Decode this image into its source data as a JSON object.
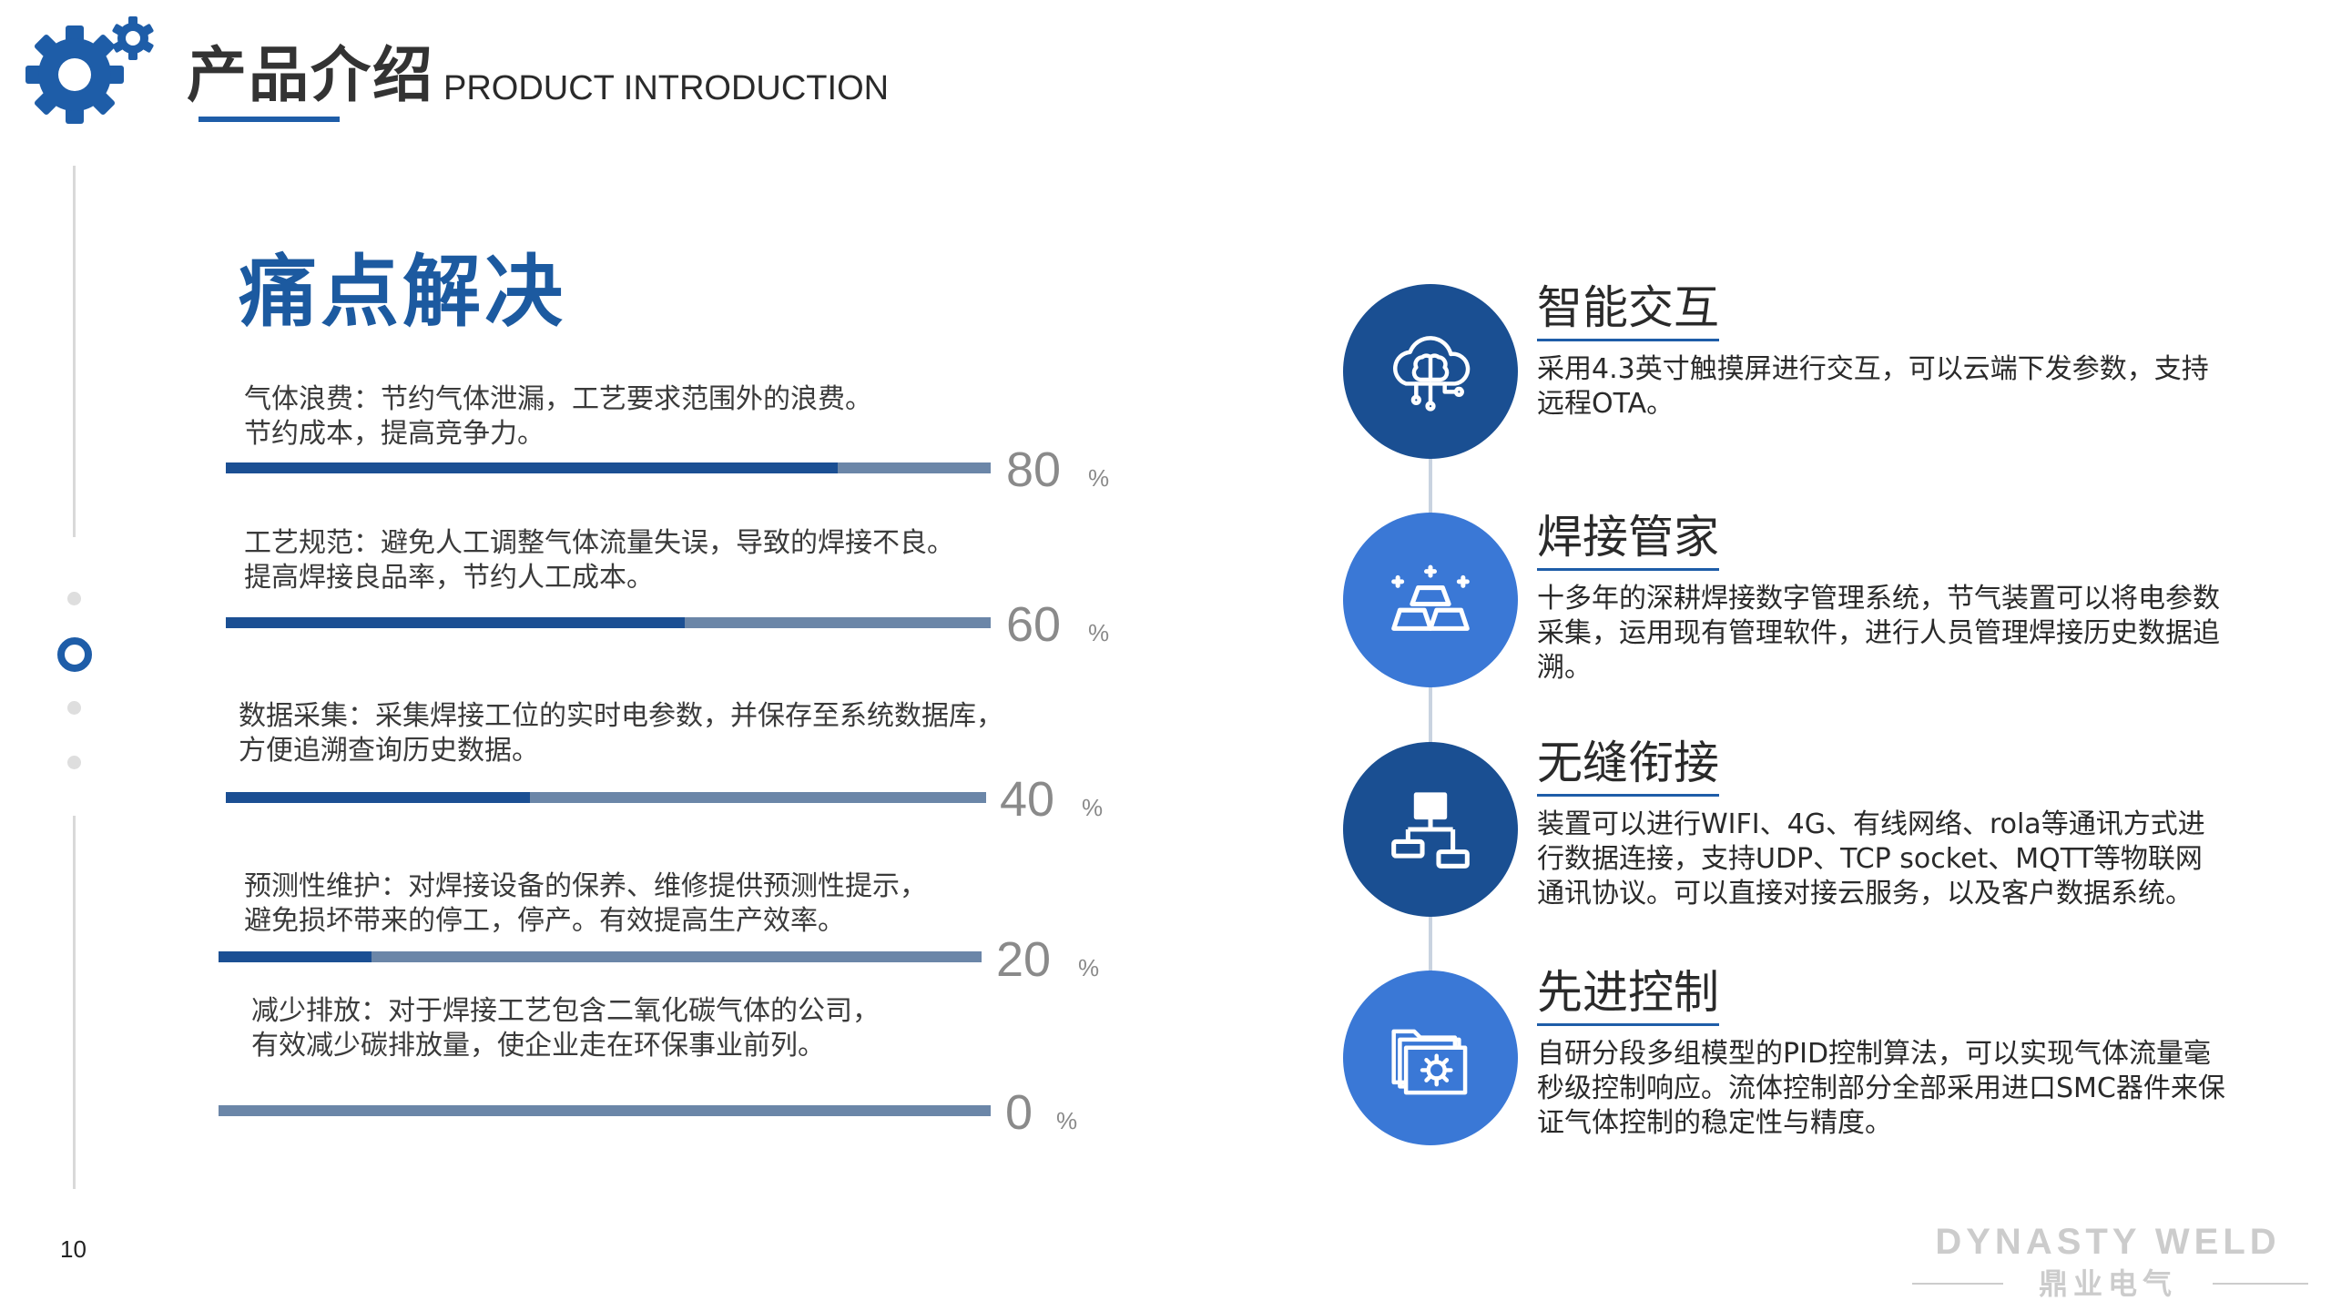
{
  "header": {
    "title_zh": "产品介绍",
    "title_en": "PRODUCT INTRODUCTION"
  },
  "section": {
    "title": "痛点解决"
  },
  "pain_points": [
    {
      "line1": "气体浪费：节约气体泄漏，工艺要求范围外的浪费。",
      "line2": "节约成本，提高竞争力。",
      "percent": 80,
      "unit": "%"
    },
    {
      "line1": "工艺规范：避免人工调整气体流量失误，导致的焊接不良。",
      "line2": "提高焊接良品率，节约人工成本。",
      "percent": 60,
      "unit": "%"
    },
    {
      "line1": "数据采集：采集焊接工位的实时电参数，并保存至系统数据库，",
      "line2": "方便追溯查询历史数据。",
      "percent": 40,
      "unit": "%"
    },
    {
      "line1": "预测性维护：对焊接设备的保养、维修提供预测性提示，",
      "line2": "避免损坏带来的停工，停产。有效提高生产效率。",
      "percent": 20,
      "unit": "%"
    },
    {
      "line1": "减少排放：对于焊接工艺包含二氧化碳气体的公司，",
      "line2": "有效减少碳排放量，使企业走在环保事业前列。",
      "percent": 0,
      "unit": "%"
    }
  ],
  "features": [
    {
      "title": "智能交互",
      "desc": "采用4.3英寸触摸屏进行交互，可以云端下发参数，支持远程OTA。",
      "icon": "cloud-brain-icon",
      "color": "#1a4f92"
    },
    {
      "title": "焊接管家",
      "desc": "十多年的深耕焊接数字管理系统，节气装置可以将电参数采集，运用现有管理软件，进行人员管理焊接历史数据追溯。",
      "icon": "gold-bars-icon",
      "color": "#3a78d6"
    },
    {
      "title": "无缝衔接",
      "desc": "装置可以进行WIFI、4G、有线网络、rola等通讯方式进行数据连接，支持UDP、TCP socket、MQTT等物联网通讯协议。可以直接对接云服务，以及客户数据系统。",
      "icon": "network-hierarchy-icon",
      "color": "#1a4f92"
    },
    {
      "title": "先进控制",
      "desc": "自研分段多组模型的PID控制算法，可以实现气体流量毫秒级控制响应。流体控制部分全部采用进口SMC器件来保证气体控制的稳定性与精度。",
      "icon": "folder-gear-icon",
      "color": "#3a78d6"
    }
  ],
  "page_number": "10",
  "brand": {
    "en": "DYNASTY WELD",
    "zh": "鼎业电气"
  },
  "colors": {
    "accent": "#1e5da8",
    "bar_fill": "#1b4f93",
    "bar_track": "#6b86a8",
    "circle_dark": "#1a4f92",
    "circle_light": "#3a78d6"
  }
}
